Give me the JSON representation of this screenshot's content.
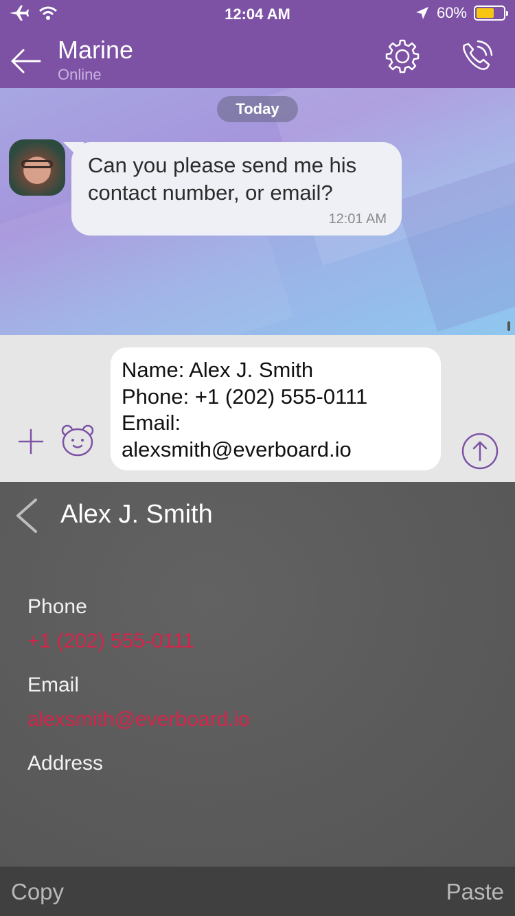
{
  "status_bar": {
    "time": "12:04 AM",
    "battery": "60%"
  },
  "header": {
    "contact_name": "Marine",
    "contact_status": "Online"
  },
  "chat": {
    "day_label": "Today",
    "messages": [
      {
        "text": "Can you please send me his contact number, or email?",
        "time": "12:01 AM"
      }
    ]
  },
  "composer": {
    "draft_lines": [
      "Name: Alex J. Smith",
      "Phone: +1 (202) 555-0111",
      "Email:",
      "alexsmith@everboard.io"
    ]
  },
  "contact_sheet": {
    "title": "Alex J. Smith",
    "phone_label": "Phone",
    "phone_value": "+1 (202) 555-0111",
    "email_label": "Email",
    "email_value": "alexsmith@everboard.io",
    "address_label": "Address"
  },
  "actions": {
    "copy": "Copy",
    "paste": "Paste"
  },
  "colors": {
    "header": "#7d52a5",
    "accent": "#7d52a5",
    "link_red": "#d4244a",
    "battery": "#f6c613"
  }
}
